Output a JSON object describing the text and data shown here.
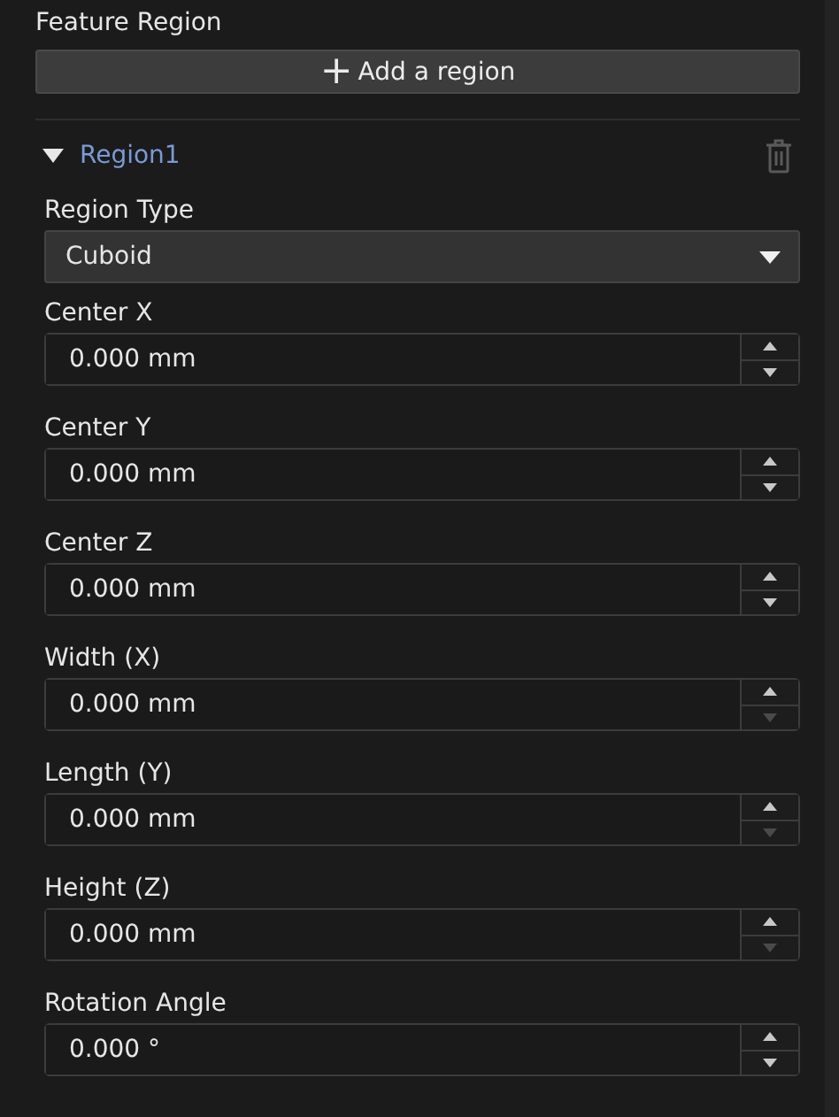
{
  "section_title": "Feature Region",
  "add_button": {
    "icon": "+",
    "label": "Add a region"
  },
  "region": {
    "name": "Region1",
    "expanded": true,
    "type_label": "Region Type",
    "type_value": "Cuboid",
    "fields": [
      {
        "label": "Center X",
        "value": "0.000 mm",
        "down_disabled": false
      },
      {
        "label": "Center Y",
        "value": "0.000 mm",
        "down_disabled": false
      },
      {
        "label": "Center Z",
        "value": "0.000 mm",
        "down_disabled": false
      },
      {
        "label": "Width (X)",
        "value": "0.000 mm",
        "down_disabled": true
      },
      {
        "label": "Length (Y)",
        "value": "0.000 mm",
        "down_disabled": true
      },
      {
        "label": "Height (Z)",
        "value": "0.000 mm",
        "down_disabled": true
      },
      {
        "label": "Rotation Angle",
        "value": "0.000 °",
        "down_disabled": false
      }
    ]
  }
}
